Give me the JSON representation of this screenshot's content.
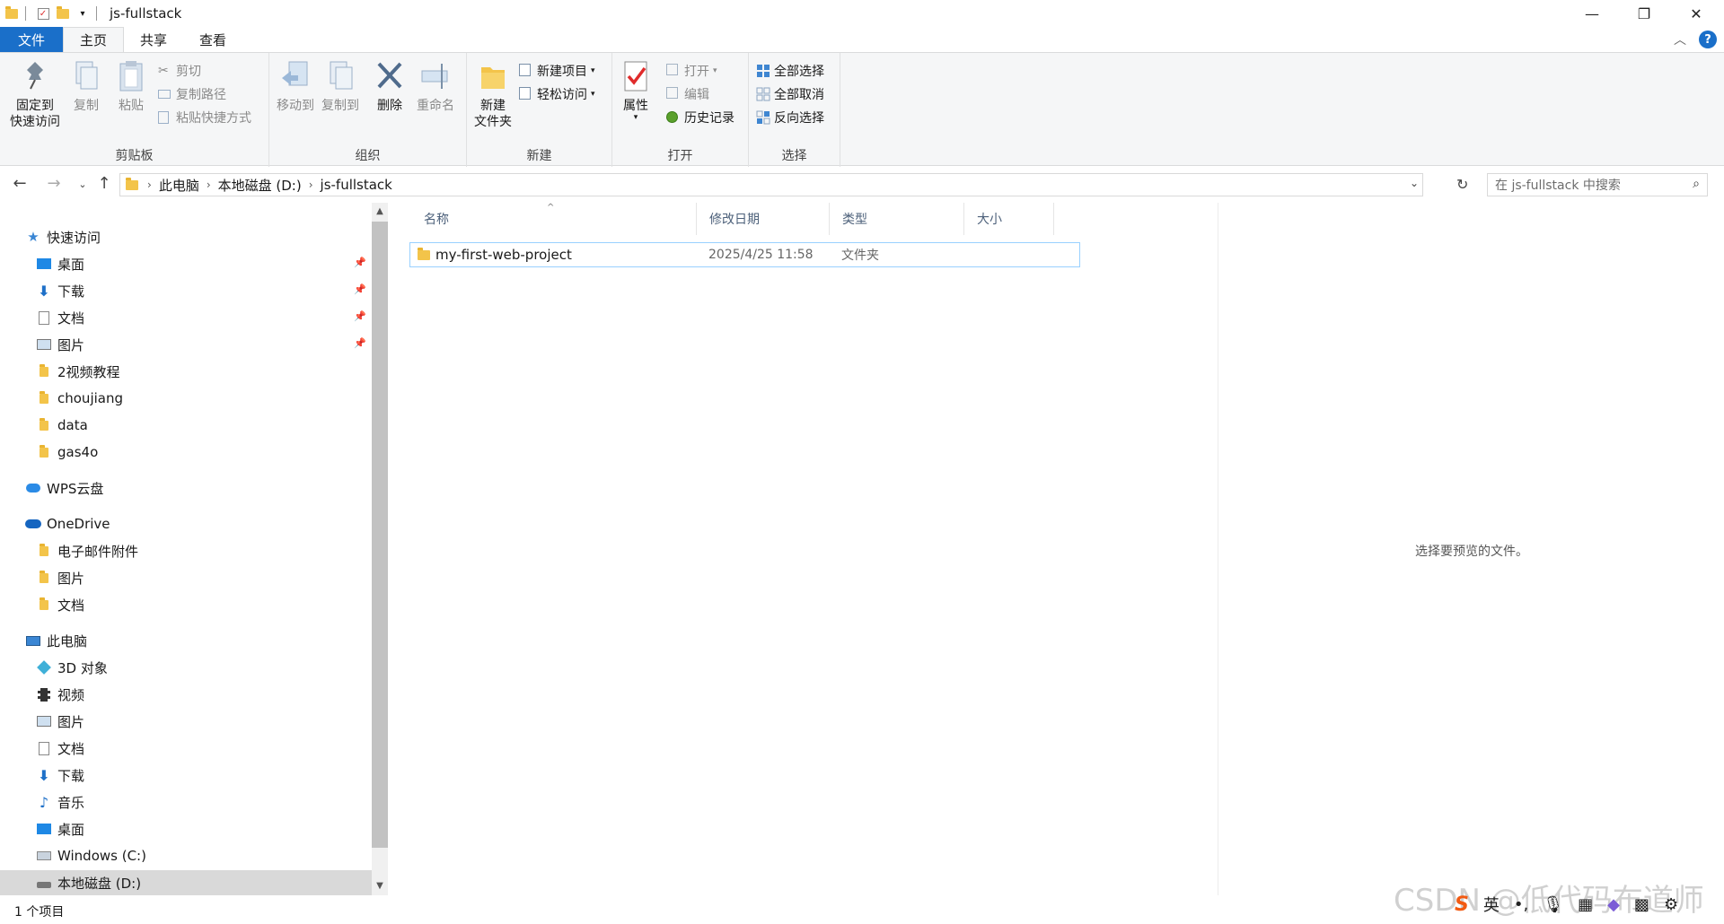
{
  "window": {
    "title": "js-fullstack",
    "minimize_glyph": "—",
    "maximize_glyph": "❐",
    "close_glyph": "✕"
  },
  "tabs": {
    "file": "文件",
    "home": "主页",
    "share": "共享",
    "view": "查看",
    "help_glyph": "?"
  },
  "ribbon": {
    "clipboard": {
      "label": "剪贴板",
      "pin": "固定到\n快速访问",
      "pin_line1": "固定到",
      "pin_line2": "快速访问",
      "copy": "复制",
      "paste": "粘贴",
      "cut": "剪切",
      "copy_path": "复制路径",
      "paste_shortcut": "粘贴快捷方式"
    },
    "organize": {
      "label": "组织",
      "move_to": "移动到",
      "copy_to": "复制到",
      "delete": "删除",
      "rename": "重命名"
    },
    "new": {
      "label": "新建",
      "new_folder_line1": "新建",
      "new_folder_line2": "文件夹",
      "new_item": "新建项目",
      "easy_access": "轻松访问"
    },
    "open": {
      "label": "打开",
      "properties": "属性",
      "open": "打开",
      "edit": "编辑",
      "history": "历史记录"
    },
    "select": {
      "label": "选择",
      "select_all": "全部选择",
      "select_none": "全部取消",
      "invert": "反向选择"
    }
  },
  "addressbar": {
    "crumbs": [
      "此电脑",
      "本地磁盘 (D:)",
      "js-fullstack"
    ],
    "search_placeholder": "在 js-fullstack 中搜索"
  },
  "navpane": {
    "quick_access": "快速访问",
    "quick_items": [
      "桌面",
      "下载",
      "文档",
      "图片",
      "2视频教程",
      "choujiang",
      "data",
      "gas4o"
    ],
    "wps": "WPS云盘",
    "onedrive": "OneDrive",
    "onedrive_items": [
      "电子邮件附件",
      "图片",
      "文档"
    ],
    "this_pc": "此电脑",
    "pc_items": [
      "3D 对象",
      "视频",
      "图片",
      "文档",
      "下载",
      "音乐",
      "桌面",
      "Windows (C:)",
      "本地磁盘 (D:)"
    ]
  },
  "filelist": {
    "columns": {
      "name": "名称",
      "date": "修改日期",
      "type": "类型",
      "size": "大小"
    },
    "rows": [
      {
        "name": "my-first-web-project",
        "date": "2025/4/25 11:58",
        "type": "文件夹",
        "size": ""
      }
    ]
  },
  "preview": {
    "message": "选择要预览的文件。"
  },
  "status": {
    "count": "1 个项目"
  },
  "ime": {
    "lang": "英"
  },
  "watermark": "CSDN @低代码布道师",
  "colors": {
    "accent": "#1a6fc9",
    "folder": "#f3c44a",
    "selected_row_border": "#99d1ff"
  }
}
